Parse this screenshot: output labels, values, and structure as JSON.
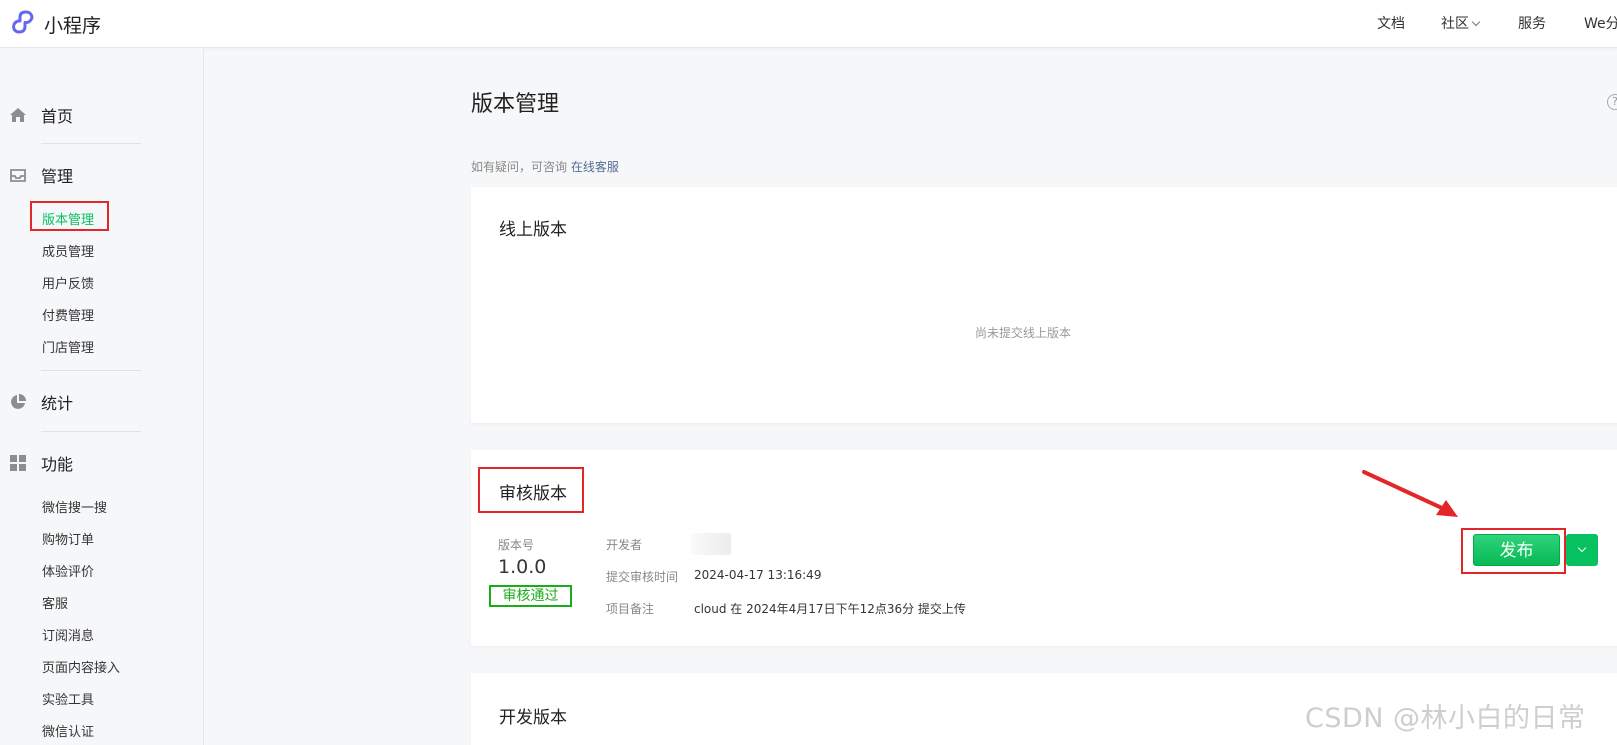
{
  "app": {
    "title": "小程序"
  },
  "topnav": {
    "items": [
      "文档",
      "社区",
      "服务",
      "We分"
    ]
  },
  "sidebar": {
    "home": "首页",
    "manage": "管理",
    "manage_items": [
      "版本管理",
      "成员管理",
      "用户反馈",
      "付费管理",
      "门店管理"
    ],
    "stats": "统计",
    "features": "功能",
    "feature_items": [
      "微信搜一搜",
      "购物订单",
      "体验评价",
      "客服",
      "订阅消息",
      "页面内容接入",
      "实验工具",
      "微信认证"
    ]
  },
  "main": {
    "title": "版本管理",
    "hint_text": "如有疑问，可咨询",
    "hint_link": "在线客服",
    "help": "?"
  },
  "online_version": {
    "title": "线上版本",
    "empty_text": "尚未提交线上版本"
  },
  "review_version": {
    "title": "审核版本",
    "version_label": "版本号",
    "version_value": "1.0.0",
    "status": "审核通过",
    "developer_label": "开发者",
    "submit_time_label": "提交审核时间",
    "submit_time_value": "2024-04-17 13:16:49",
    "remark_label": "项目备注",
    "remark_value": "cloud 在 2024年4月17日下午12点36分 提交上传",
    "publish_label": "发布"
  },
  "dev_version": {
    "title": "开发版本"
  },
  "watermark": "CSDN @林小白的日常",
  "colors": {
    "accent": "#07c160",
    "annotation": "#e3262a",
    "link": "#576b95"
  }
}
